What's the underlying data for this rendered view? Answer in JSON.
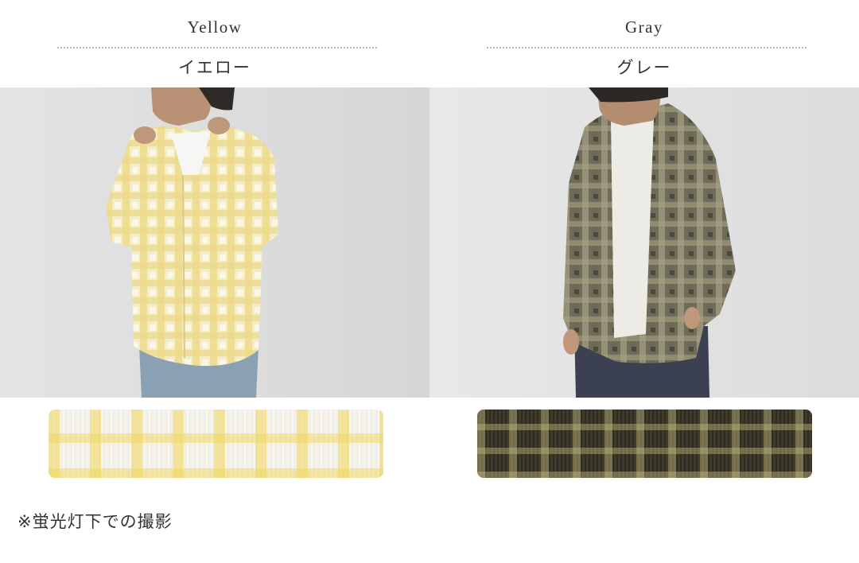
{
  "variants": [
    {
      "name_en": "Yellow",
      "name_ja": "イエロー",
      "swatch_color": "#f2e7a8"
    },
    {
      "name_en": "Gray",
      "name_ja": "グレー",
      "swatch_color": "#4a4634"
    }
  ],
  "note": "※蛍光灯下での撮影",
  "colors": {
    "text": "#333333",
    "divider": "#b8b8b8",
    "background": "#ffffff"
  }
}
